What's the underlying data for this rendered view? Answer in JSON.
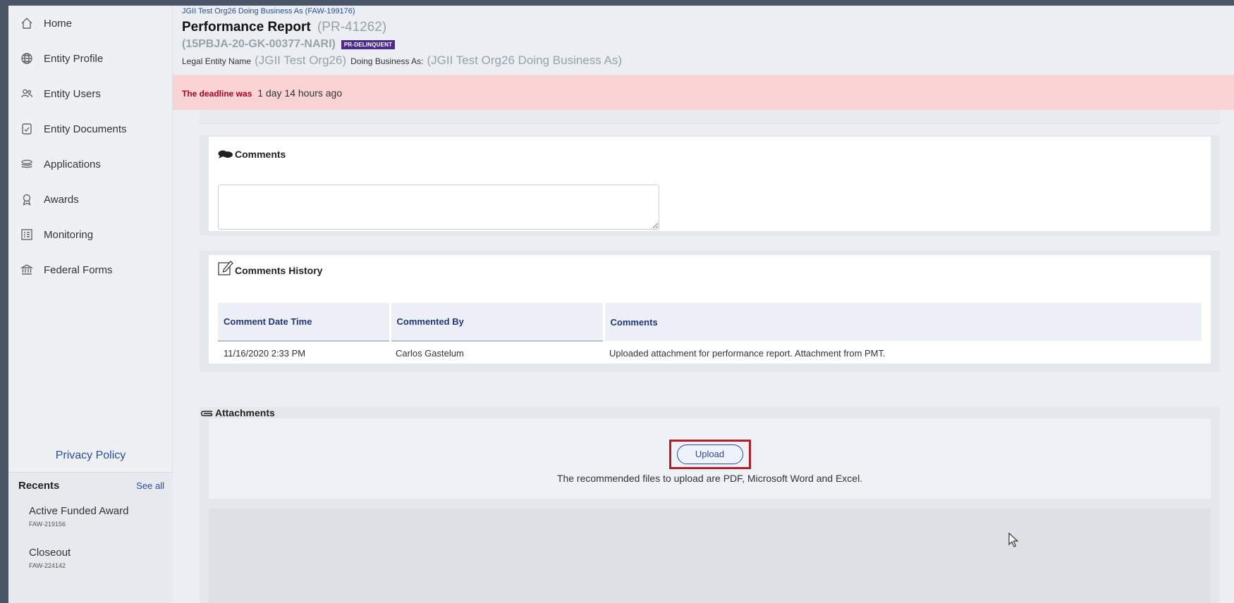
{
  "sidebar": {
    "items": [
      {
        "label": "Home",
        "icon": "home-icon"
      },
      {
        "label": "Entity Profile",
        "icon": "globe-icon"
      },
      {
        "label": "Entity Users",
        "icon": "users-icon"
      },
      {
        "label": "Entity Documents",
        "icon": "document-icon"
      },
      {
        "label": "Applications",
        "icon": "stack-icon"
      },
      {
        "label": "Awards",
        "icon": "award-icon"
      },
      {
        "label": "Monitoring",
        "icon": "list-icon"
      },
      {
        "label": "Federal Forms",
        "icon": "bank-icon"
      }
    ],
    "privacy": "Privacy Policy",
    "recents": {
      "title": "Recents",
      "see_all": "See all",
      "items": [
        {
          "title": "Active Funded Award",
          "code": "FAW-219156"
        },
        {
          "title": "Closeout",
          "code": "FAW-224142"
        }
      ]
    }
  },
  "header": {
    "breadcrumb": "JGII Test Org26 Doing Business As (FAW-199176)",
    "title": "Performance Report",
    "report_id": "(PR-41262)",
    "grant_id": "(15PBJA-20-GK-00377-NARI)",
    "badge": "PR-DELINQUENT",
    "legal_label": "Legal Entity Name",
    "legal_value": "(JGII Test Org26)",
    "dba_label": "Doing Business As:",
    "dba_value": "(JGII Test Org26 Doing Business As)"
  },
  "alert": {
    "label": "The deadline was",
    "value": "1 day 14 hours ago"
  },
  "comments": {
    "title": "Comments",
    "value": ""
  },
  "history": {
    "title": "Comments History",
    "columns": [
      "Comment Date Time",
      "Commented By",
      "Comments"
    ],
    "rows": [
      [
        "11/16/2020 2:33 PM",
        "Carlos Gastelum",
        "Uploaded attachment for performance report. Attachment from PMT."
      ]
    ]
  },
  "attachments": {
    "title": "Attachments",
    "upload_label": "Upload",
    "note": "The recommended files to upload are PDF, Microsoft Word and Excel."
  },
  "colors": {
    "badge": "#4b2a8a",
    "alert_bg": "#fad3d5",
    "link": "#2a4d9b",
    "highlight": "#b21f2d"
  }
}
